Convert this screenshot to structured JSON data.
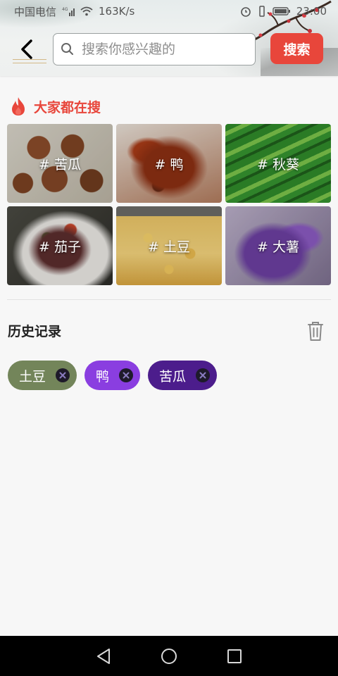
{
  "status_bar": {
    "carrier": "中国电信",
    "net_badge": "4G",
    "speed": "163K/s",
    "time": "23:00",
    "icons": [
      "signal-icon",
      "wifi-icon",
      "alarm-icon",
      "vibrate-icon",
      "battery-icon"
    ]
  },
  "header": {
    "back_icon": "chevron-left-icon",
    "search_placeholder": "搜索你感兴趣的",
    "search_button": "搜索"
  },
  "hot_search": {
    "title": "大家都在搜",
    "icon": "fire-icon",
    "accent_color": "#e8463b",
    "items": [
      {
        "label": "# 苦瓜"
      },
      {
        "label": "# 鸭"
      },
      {
        "label": "# 秋葵"
      },
      {
        "label": "# 茄子"
      },
      {
        "label": "# 土豆"
      },
      {
        "label": "# 大薯"
      }
    ]
  },
  "history": {
    "title": "历史记录",
    "clear_icon": "trash-icon",
    "chips": [
      {
        "label": "土豆",
        "color": "#73855a"
      },
      {
        "label": "鸭",
        "color": "#8a3ee0"
      },
      {
        "label": "苦瓜",
        "color": "#4c1d8c"
      }
    ]
  },
  "nav_bar": {
    "icons": [
      "back-triangle-icon",
      "home-circle-icon",
      "recents-square-icon"
    ]
  }
}
